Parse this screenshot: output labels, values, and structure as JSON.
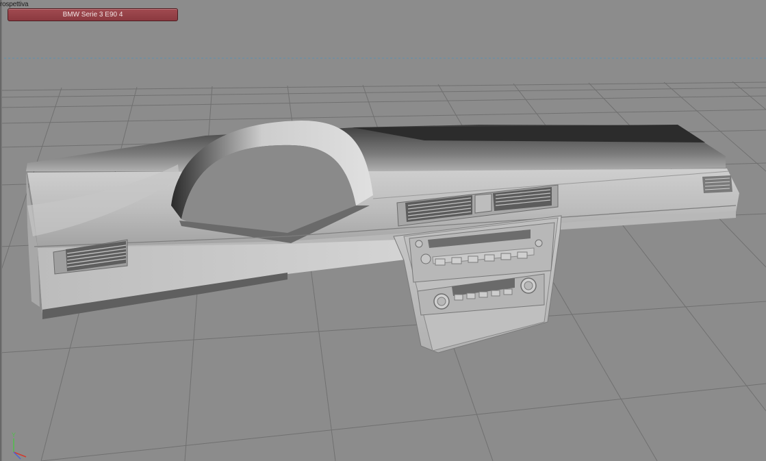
{
  "viewport": {
    "label": "rospettiva",
    "object_name": "BMW Serie 3 E90 4",
    "axis_labels": {
      "y": "Y"
    }
  },
  "colors": {
    "background": "#8c8c8c",
    "grid_line": "#6e6e6e",
    "horizon_dash": "#5d8fb0",
    "object_tag": "#8b3a40",
    "axis_x": "#d23a2e",
    "axis_y": "#4fbf4a",
    "axis_z": "#4a62d6"
  }
}
